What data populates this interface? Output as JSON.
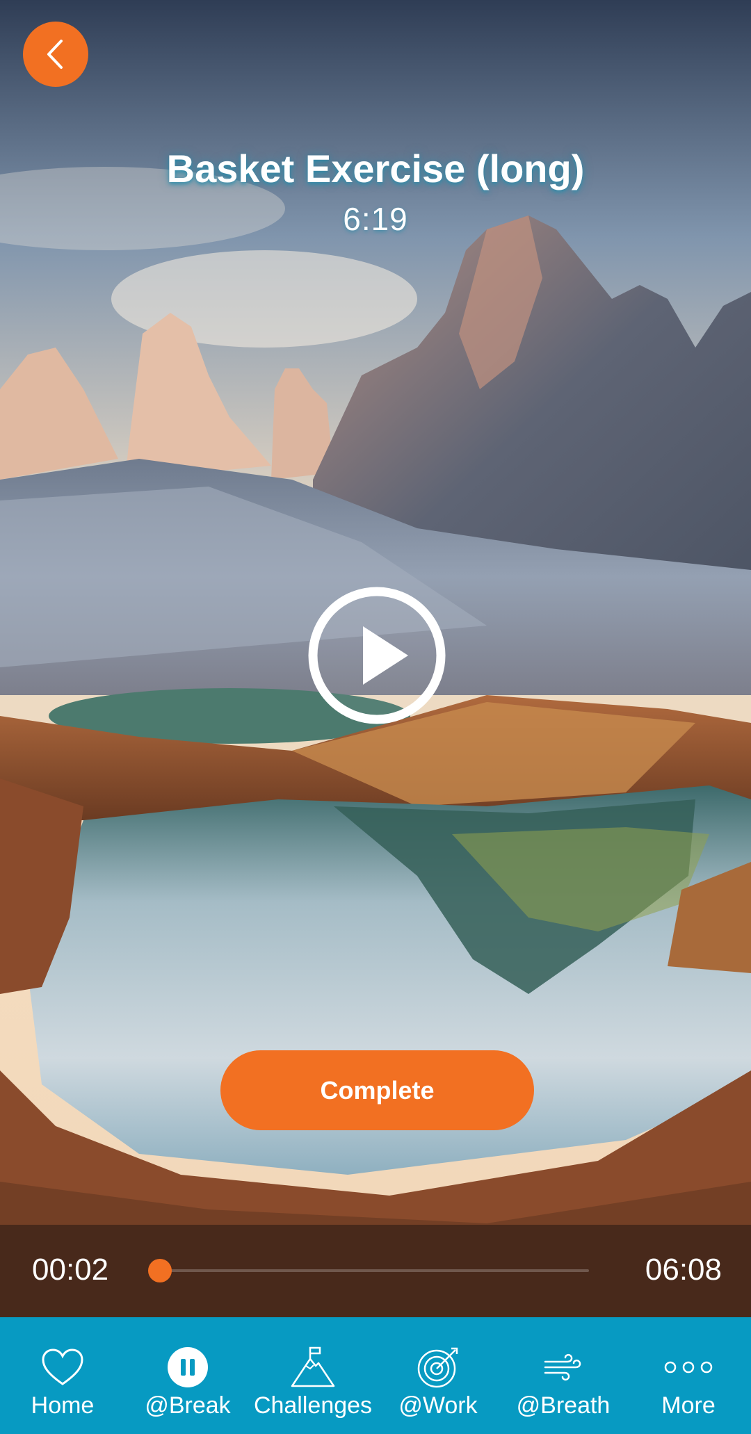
{
  "header": {
    "title": "Basket Exercise (long)",
    "duration": "6:19"
  },
  "actions": {
    "complete_label": "Complete"
  },
  "player": {
    "elapsed": "00:02",
    "total": "06:08",
    "progress": 0.005
  },
  "tabs": [
    {
      "label": "Home",
      "icon": "heart-icon"
    },
    {
      "label": "@Break",
      "icon": "pause-circle-icon",
      "active": true
    },
    {
      "label": "Challenges",
      "icon": "mountain-flag-icon"
    },
    {
      "label": "@Work",
      "icon": "target-icon"
    },
    {
      "label": "@Breath",
      "icon": "wind-icon"
    },
    {
      "label": "More",
      "icon": "more-dots-icon"
    }
  ],
  "colors": {
    "accent": "#f27022",
    "tabbar": "#079ac2"
  }
}
